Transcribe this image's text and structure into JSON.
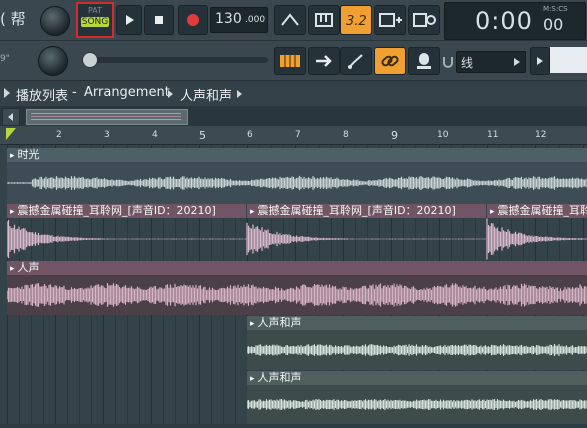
{
  "app": {
    "hint_text": "( 帮"
  },
  "transport": {
    "mode_pat": "PAT",
    "mode_song": "SONG",
    "tempo": "130",
    "tempo_decimal": ".000",
    "time_display": "0:00",
    "time_sub": "00",
    "time_units": "M:S:CS"
  },
  "toolbar2": {
    "left_label": "9\"",
    "snap_value": "线"
  },
  "breadcrumb": {
    "playlist": "播放列表",
    "sep": "-",
    "arrangement": "Arrangement",
    "pattern": "人声和声"
  },
  "ruler": {
    "bars": [
      "2",
      "3",
      "4",
      "5",
      "6",
      "7",
      "8",
      "9",
      "10",
      "11",
      "12"
    ]
  },
  "tracks": {
    "t1": {
      "label": "时光"
    },
    "t2": {
      "label": "震撼金属碰撞_耳聆网_[声音ID：20210]"
    },
    "t3": {
      "label": "人声"
    },
    "t4": {
      "label": "人声和声"
    },
    "t5": {
      "label": "人声和声"
    }
  },
  "colors": {
    "accent_orange": "#f0a030",
    "song_green": "#b8d73a",
    "record_red": "#e23b3b",
    "clip_gray": "#4a5a62",
    "clip_pink": "#7a5566",
    "clip_green": "#4b5d5b"
  }
}
